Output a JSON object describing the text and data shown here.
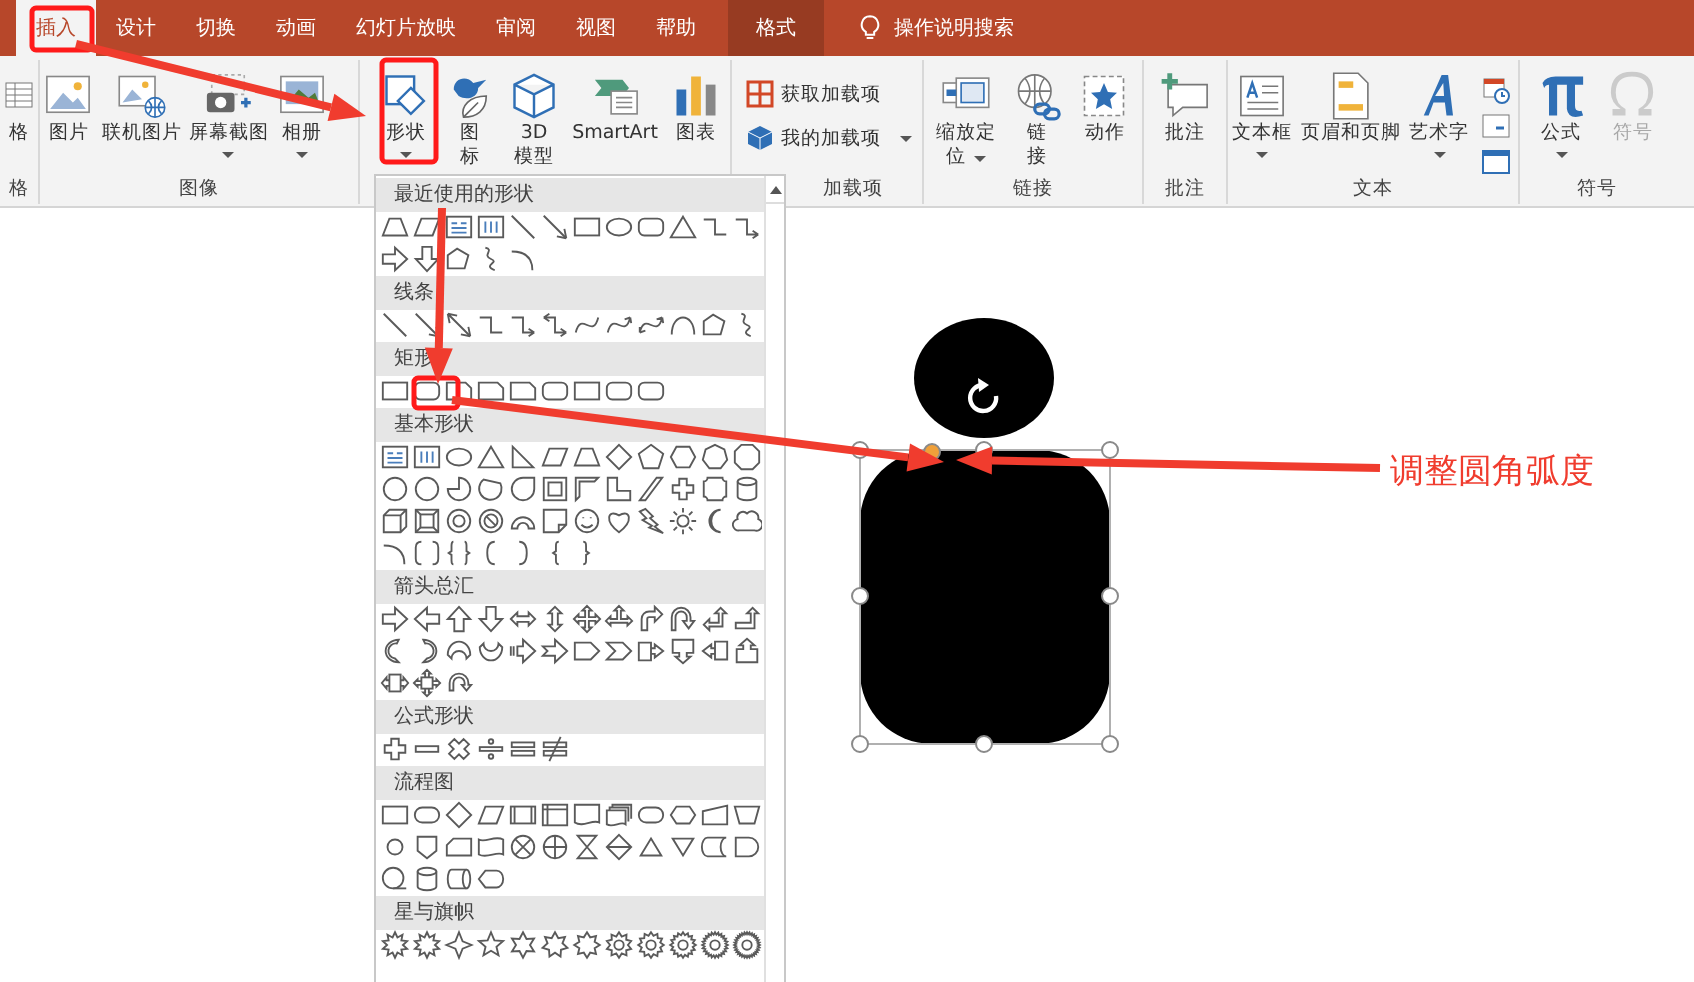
{
  "tabs": [
    {
      "label": "插入",
      "selected": true,
      "contextual": false
    },
    {
      "label": "设计",
      "selected": false,
      "contextual": false
    },
    {
      "label": "切换",
      "selected": false,
      "contextual": false
    },
    {
      "label": "动画",
      "selected": false,
      "contextual": false
    },
    {
      "label": "幻灯片放映",
      "selected": false,
      "contextual": false
    },
    {
      "label": "审阅",
      "selected": false,
      "contextual": false
    },
    {
      "label": "视图",
      "selected": false,
      "contextual": false
    },
    {
      "label": "帮助",
      "selected": false,
      "contextual": false
    },
    {
      "label": "格式",
      "selected": false,
      "contextual": true
    }
  ],
  "search": {
    "placeholder": "操作说明搜索"
  },
  "ribbon": {
    "groups": [
      {
        "label": "格",
        "items": [
          {
            "lines": [
              "格"
            ],
            "kind": "large",
            "caret": false,
            "disabled": false
          }
        ]
      },
      {
        "label": "图像",
        "items": [
          {
            "lines": [
              "图片"
            ],
            "kind": "large",
            "caret": false,
            "disabled": false
          },
          {
            "lines": [
              "联机图片"
            ],
            "kind": "large",
            "caret": false,
            "disabled": false
          },
          {
            "lines": [
              "屏幕截图"
            ],
            "kind": "large",
            "caret": true,
            "disabled": false
          },
          {
            "lines": [
              "相册"
            ],
            "kind": "large",
            "caret": true,
            "disabled": false
          }
        ]
      },
      {
        "items": [
          {
            "lines": [
              "形状"
            ],
            "kind": "large",
            "caret": true,
            "disabled": false
          },
          {
            "lines": [
              "图",
              "标"
            ],
            "kind": "large",
            "caret": false,
            "disabled": false
          },
          {
            "lines": [
              "3D",
              "模型"
            ],
            "kind": "large",
            "caret": false,
            "disabled": false
          },
          {
            "lines": [
              "SmartArt"
            ],
            "kind": "large",
            "caret": false,
            "disabled": false
          },
          {
            "lines": [
              "图表"
            ],
            "kind": "large",
            "caret": false,
            "disabled": false
          }
        ]
      },
      {
        "label": "加载项",
        "items": [
          {
            "label": "获取加载项",
            "kind": "small",
            "caret": false,
            "disabled": false
          },
          {
            "label": "我的加载项",
            "kind": "small",
            "caret": true,
            "disabled": false
          }
        ]
      },
      {
        "label": "链接",
        "items": [
          {
            "lines": [
              "缩放定",
              "位"
            ],
            "kind": "large",
            "caret": true,
            "disabled": false
          },
          {
            "lines": [
              "链",
              "接"
            ],
            "kind": "large",
            "caret": false,
            "disabled": false
          },
          {
            "lines": [
              "动作"
            ],
            "kind": "large",
            "caret": false,
            "disabled": false
          }
        ]
      },
      {
        "label": "批注",
        "items": [
          {
            "lines": [
              "批注"
            ],
            "kind": "large",
            "caret": false,
            "disabled": false
          }
        ]
      },
      {
        "label": "文本",
        "items": [
          {
            "lines": [
              "文本框"
            ],
            "kind": "large",
            "caret": true,
            "disabled": false
          },
          {
            "lines": [
              "页眉和页脚"
            ],
            "kind": "large",
            "caret": false,
            "disabled": false
          },
          {
            "lines": [
              "艺术字"
            ],
            "kind": "large",
            "caret": true,
            "disabled": false
          },
          {
            "kind": "icon",
            "caret": false,
            "disabled": false
          },
          {
            "kind": "icon",
            "caret": false,
            "disabled": false
          },
          {
            "kind": "icon",
            "caret": false,
            "disabled": false
          }
        ]
      },
      {
        "label": "符号",
        "items": [
          {
            "lines": [
              "公式"
            ],
            "kind": "large",
            "caret": true,
            "disabled": false
          },
          {
            "lines": [
              "符号"
            ],
            "kind": "large",
            "caret": false,
            "disabled": true
          }
        ]
      }
    ]
  },
  "shapes_menu": {
    "sections": [
      {
        "title": "最近使用的形状",
        "shapes": [
          {
            "kind": "trapezoid"
          },
          {
            "kind": "parallelogram"
          },
          {
            "kind": "textbox"
          },
          {
            "kind": "vtextbox"
          },
          {
            "kind": "line"
          },
          {
            "kind": "arrow-line"
          },
          {
            "kind": "rect"
          },
          {
            "kind": "oval"
          },
          {
            "kind": "rounded"
          },
          {
            "kind": "triangle"
          },
          {
            "kind": "elbow"
          },
          {
            "kind": "elbow-arrow"
          },
          {
            "kind": "right-arrow"
          },
          {
            "kind": "down-arrow"
          },
          {
            "kind": "freeform"
          },
          {
            "kind": "scribble"
          },
          {
            "kind": "arc"
          }
        ]
      },
      {
        "title": "线条",
        "shapes": [
          {
            "kind": "line"
          },
          {
            "kind": "arrow-line"
          },
          {
            "kind": "double-arrow-line"
          },
          {
            "kind": "elbow"
          },
          {
            "kind": "elbow-arrow"
          },
          {
            "kind": "elbow-double"
          },
          {
            "kind": "curve"
          },
          {
            "kind": "curve-arrow"
          },
          {
            "kind": "curve-double"
          },
          {
            "kind": "arch"
          },
          {
            "kind": "freeform"
          },
          {
            "kind": "scribble"
          }
        ]
      },
      {
        "title": "矩形",
        "shapes": [
          {
            "kind": "rect"
          },
          {
            "kind": "rounded"
          },
          {
            "kind": "snipped"
          },
          {
            "kind": "snipped"
          },
          {
            "kind": "snipped"
          },
          {
            "kind": "rounded"
          },
          {
            "kind": "rect"
          },
          {
            "kind": "rounded"
          },
          {
            "kind": "rounded"
          }
        ]
      },
      {
        "title": "基本形状",
        "shapes": [
          {
            "kind": "textbox"
          },
          {
            "kind": "vtextbox"
          },
          {
            "kind": "oval"
          },
          {
            "kind": "triangle"
          },
          {
            "kind": "right-triangle"
          },
          {
            "kind": "parallelogram"
          },
          {
            "kind": "trapezoid"
          },
          {
            "kind": "diamond"
          },
          {
            "kind": "pentagon"
          },
          {
            "kind": "hexagon"
          },
          {
            "kind": "heptagon"
          },
          {
            "kind": "octagon"
          },
          {
            "kind": "circle"
          },
          {
            "kind": "circle"
          },
          {
            "kind": "pie"
          },
          {
            "kind": "chord"
          },
          {
            "kind": "teardrop"
          },
          {
            "kind": "frame"
          },
          {
            "kind": "half-frame"
          },
          {
            "kind": "l-shape"
          },
          {
            "kind": "slash"
          },
          {
            "kind": "plus"
          },
          {
            "kind": "plaque"
          },
          {
            "kind": "can"
          },
          {
            "kind": "cube"
          },
          {
            "kind": "bevel"
          },
          {
            "kind": "donut"
          },
          {
            "kind": "no-symbol"
          },
          {
            "kind": "block-arc"
          },
          {
            "kind": "folded"
          },
          {
            "kind": "smiley"
          },
          {
            "kind": "heart"
          },
          {
            "kind": "lightning"
          },
          {
            "kind": "sun"
          },
          {
            "kind": "moon"
          },
          {
            "kind": "cloud"
          },
          {
            "kind": "arc"
          },
          {
            "kind": "bracket-pair"
          },
          {
            "kind": "brace-pair"
          },
          {
            "kind": "left-bracket"
          },
          {
            "kind": "right-bracket"
          },
          {
            "kind": "left-brace"
          },
          {
            "kind": "right-brace"
          }
        ]
      },
      {
        "title": "箭头总汇",
        "shapes": [
          {
            "kind": "right-arrow"
          },
          {
            "kind": "left-arrow"
          },
          {
            "kind": "up-arrow"
          },
          {
            "kind": "down-arrow"
          },
          {
            "kind": "left-right-arrow"
          },
          {
            "kind": "up-down-arrow"
          },
          {
            "kind": "quad-arrow"
          },
          {
            "kind": "tri-arrow"
          },
          {
            "kind": "bent-arrow"
          },
          {
            "kind": "u-turn"
          },
          {
            "kind": "left-up-arrow"
          },
          {
            "kind": "bent-up-arrow"
          },
          {
            "kind": "curved-right"
          },
          {
            "kind": "curved-left"
          },
          {
            "kind": "curved-up"
          },
          {
            "kind": "curved-down"
          },
          {
            "kind": "striped-arrow"
          },
          {
            "kind": "notched-arrow"
          },
          {
            "kind": "home-plate"
          },
          {
            "kind": "chevron"
          },
          {
            "kind": "callout-right"
          },
          {
            "kind": "callout-down"
          },
          {
            "kind": "callout-left"
          },
          {
            "kind": "callout-up"
          },
          {
            "kind": "callout-left-right"
          },
          {
            "kind": "callout-quad"
          },
          {
            "kind": "circular-arrow"
          }
        ]
      },
      {
        "title": "公式形状",
        "shapes": [
          {
            "kind": "plus"
          },
          {
            "kind": "minus"
          },
          {
            "kind": "times"
          },
          {
            "kind": "divide"
          },
          {
            "kind": "equal"
          },
          {
            "kind": "not-equal"
          }
        ]
      },
      {
        "title": "流程图",
        "shapes": [
          {
            "kind": "process"
          },
          {
            "kind": "terminator"
          },
          {
            "kind": "diamond"
          },
          {
            "kind": "data"
          },
          {
            "kind": "predefined"
          },
          {
            "kind": "internal"
          },
          {
            "kind": "document"
          },
          {
            "kind": "multi-document"
          },
          {
            "kind": "terminator"
          },
          {
            "kind": "preparation"
          },
          {
            "kind": "manual-input"
          },
          {
            "kind": "manual-op"
          },
          {
            "kind": "connector"
          },
          {
            "kind": "off-page"
          },
          {
            "kind": "card"
          },
          {
            "kind": "tape"
          },
          {
            "kind": "summing"
          },
          {
            "kind": "or"
          },
          {
            "kind": "collate"
          },
          {
            "kind": "sort"
          },
          {
            "kind": "extract"
          },
          {
            "kind": "merge"
          },
          {
            "kind": "stored"
          },
          {
            "kind": "delay"
          },
          {
            "kind": "sequential"
          },
          {
            "kind": "can"
          },
          {
            "kind": "direct"
          },
          {
            "kind": "display"
          }
        ]
      },
      {
        "title": "星与旗帜",
        "shapes": [
          {
            "kind": "burst"
          },
          {
            "kind": "burst"
          },
          {
            "kind": "star4"
          },
          {
            "kind": "star5"
          },
          {
            "kind": "star6"
          },
          {
            "kind": "star7"
          },
          {
            "kind": "star8"
          },
          {
            "kind": "star10"
          },
          {
            "kind": "star12"
          },
          {
            "kind": "star16"
          },
          {
            "kind": "star24"
          },
          {
            "kind": "star32"
          }
        ]
      }
    ]
  },
  "annotation": {
    "text": "调整圆角弧度"
  }
}
